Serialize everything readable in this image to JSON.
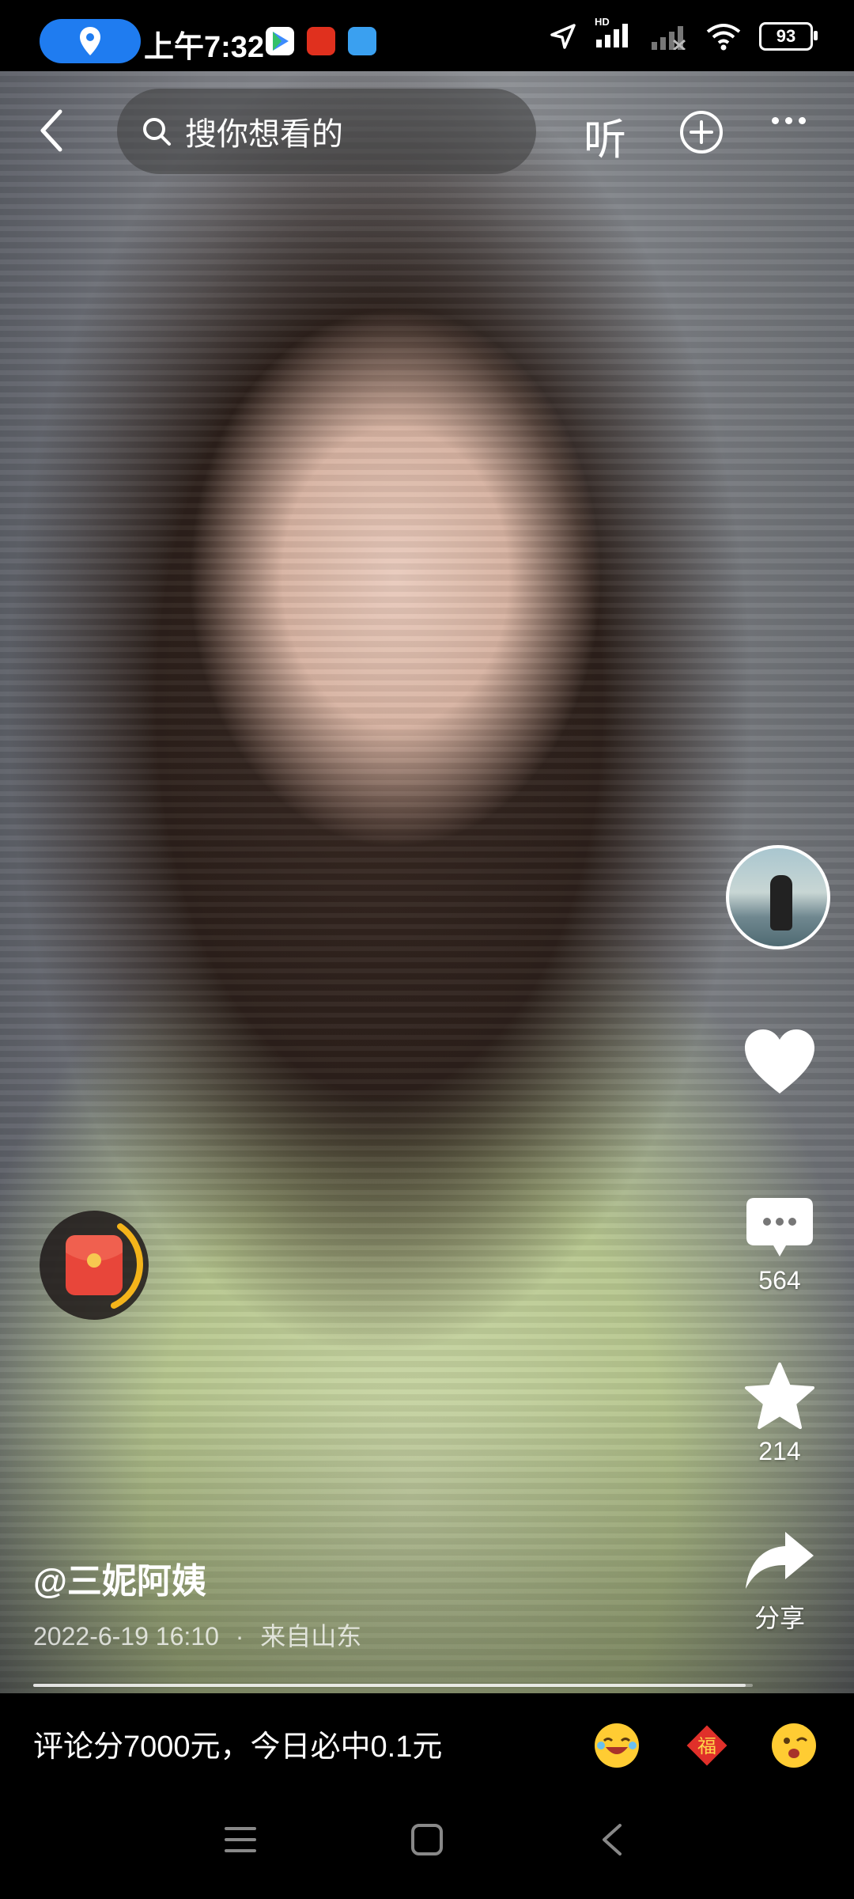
{
  "status_bar": {
    "time": "上午7:32",
    "battery": "93",
    "network": "HD"
  },
  "top_nav": {
    "search_placeholder": "搜你想看的",
    "listen_label": "听"
  },
  "right_rail": {
    "comments_count": "564",
    "favorites_count": "214",
    "share_label": "分享"
  },
  "video": {
    "username": "@三妮阿姨",
    "date": "2022-6-19 16:10",
    "separator": "·",
    "location": "来自山东",
    "progress": 0.99
  },
  "comment_bar": {
    "prompt": "评论分7000元，今日必中0.1元",
    "emoji_2_char": "福"
  },
  "colors": {
    "location_pill": "#1f7cf0",
    "red_packet": "#e8463a",
    "red_packet_ring": "#f4b41a"
  }
}
